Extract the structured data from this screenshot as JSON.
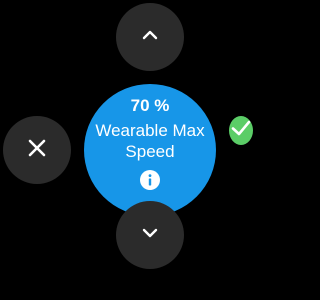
{
  "setting": {
    "value": "70 %",
    "label": "Wearable Max Speed"
  },
  "icons": {
    "up": "chevron-up-icon",
    "down": "chevron-down-icon",
    "cancel": "close-icon",
    "confirm": "check-icon",
    "info": "info-icon"
  },
  "colors": {
    "background": "#000000",
    "control_button": "#2b2b2b",
    "confirm_button": "#5bcd67",
    "center_dial": "#1796e8",
    "text": "#ffffff"
  }
}
